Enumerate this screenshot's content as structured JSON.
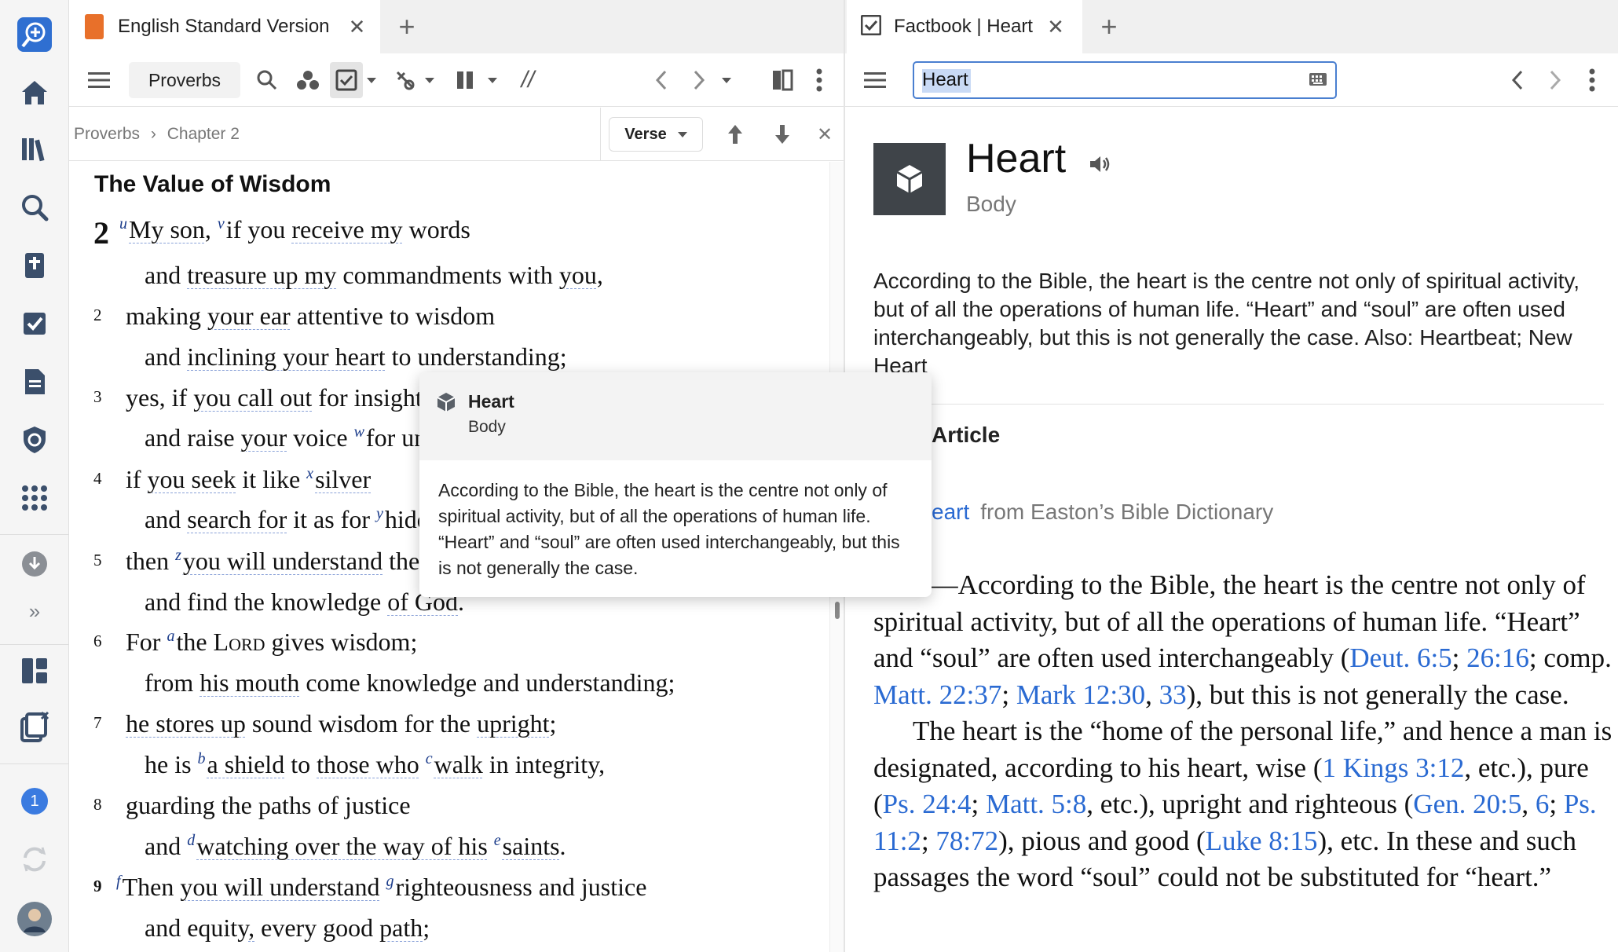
{
  "left_panel": {
    "tab_label": "English Standard Version",
    "book_button": "Proverbs",
    "breadcrumb": {
      "book": "Proverbs",
      "chapter": "Chapter 2",
      "separator": "›"
    },
    "verse_select": "Verse",
    "heading": "The Value of Wisdom",
    "chapter_number": "2"
  },
  "popup": {
    "title": "Heart",
    "subtitle": "Body",
    "body": "According to the Bible, the heart is the centre not only of spiritual activity, but of all the operations of human life. “Heart” and “soul” are often used interchangeably, but this is not generally the case."
  },
  "right_panel": {
    "tab_label": "Factbook | Heart",
    "search_value": "Heart",
    "title": "Heart",
    "subtitle": "Body",
    "description": "According to the Bible, the heart is the centre not only of spiritual activity, but of all the operations of human life. “Heart” and “soul” are often used interchangeably, but this is not generally the case. Also: Heartbeat; New Heart",
    "article_label": "Article",
    "article_link": "eart",
    "article_source": "from Easton’s Bible Dictionary"
  },
  "sidebar": {
    "notification_count": "1"
  },
  "colors": {
    "link": "#2a6ad2",
    "accent": "#e8702a",
    "footnote": "#1a3b8a"
  }
}
